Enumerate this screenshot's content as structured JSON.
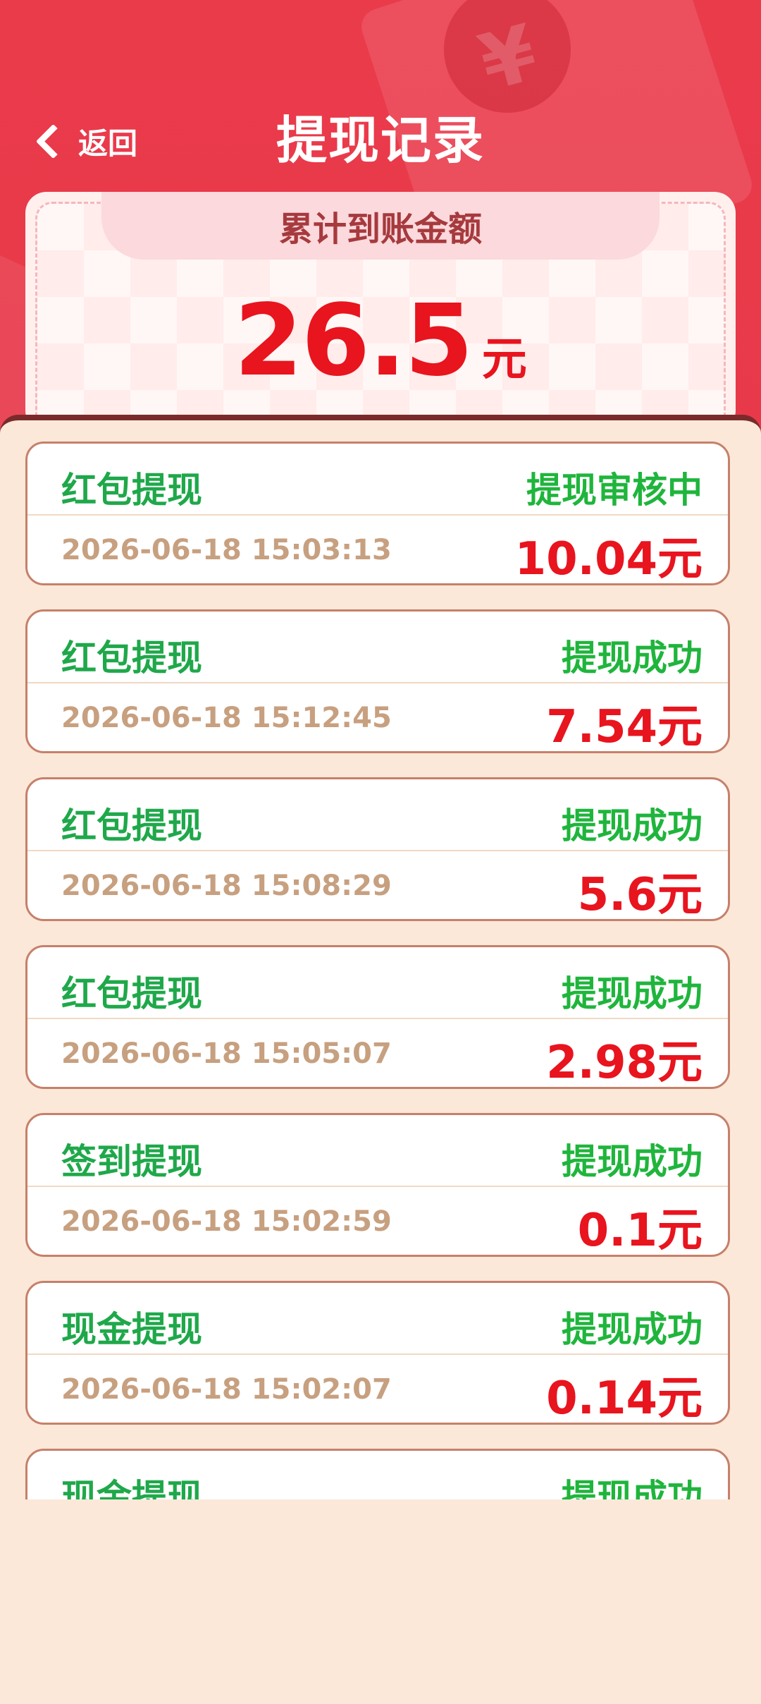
{
  "header": {
    "back_label": "返回",
    "title": "提现记录",
    "decor_symbol": "¥"
  },
  "summary": {
    "label": "累计到账金额",
    "amount": "26.5",
    "unit": "元"
  },
  "records": [
    {
      "type": "红包提现",
      "status": "提现审核中",
      "time": "2026-06-18 15:03:13",
      "amount": "10.04元"
    },
    {
      "type": "红包提现",
      "status": "提现成功",
      "time": "2026-06-18 15:12:45",
      "amount": "7.54元"
    },
    {
      "type": "红包提现",
      "status": "提现成功",
      "time": "2026-06-18 15:08:29",
      "amount": "5.6元"
    },
    {
      "type": "红包提现",
      "status": "提现成功",
      "time": "2026-06-18 15:05:07",
      "amount": "2.98元"
    },
    {
      "type": "签到提现",
      "status": "提现成功",
      "time": "2026-06-18 15:02:59",
      "amount": "0.1元"
    },
    {
      "type": "现金提现",
      "status": "提现成功",
      "time": "2026-06-18 15:02:07",
      "amount": "0.14元"
    },
    {
      "type": "现金提现",
      "status": "提现成功",
      "time": "",
      "amount": ""
    }
  ],
  "colors": {
    "brand_red": "#e93a4b",
    "amount_red": "#e8141e",
    "status_green": "#1fb53c",
    "panel_bg": "#fbe8d9"
  }
}
